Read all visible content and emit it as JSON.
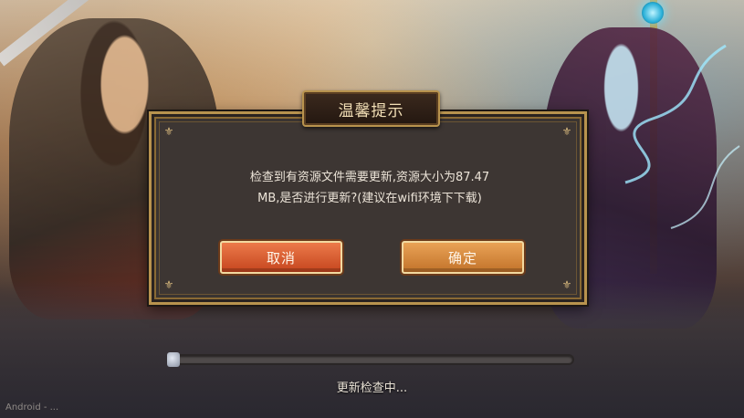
{
  "dialog": {
    "title": "温馨提示",
    "message_line1": "检查到有资源文件需要更新,资源大小为87.47",
    "message_line2": "MB,是否进行更新?(建议在wifi环境下下载)",
    "cancel_label": "取消",
    "confirm_label": "确定"
  },
  "loading": {
    "status_text": "更新检查中...",
    "progress": 0.0
  },
  "footer": {
    "version_text": "Android - ..."
  },
  "colors": {
    "accent_gold": "#b8934e",
    "cancel_button": "#d9582c",
    "confirm_button": "#d88a3e"
  }
}
